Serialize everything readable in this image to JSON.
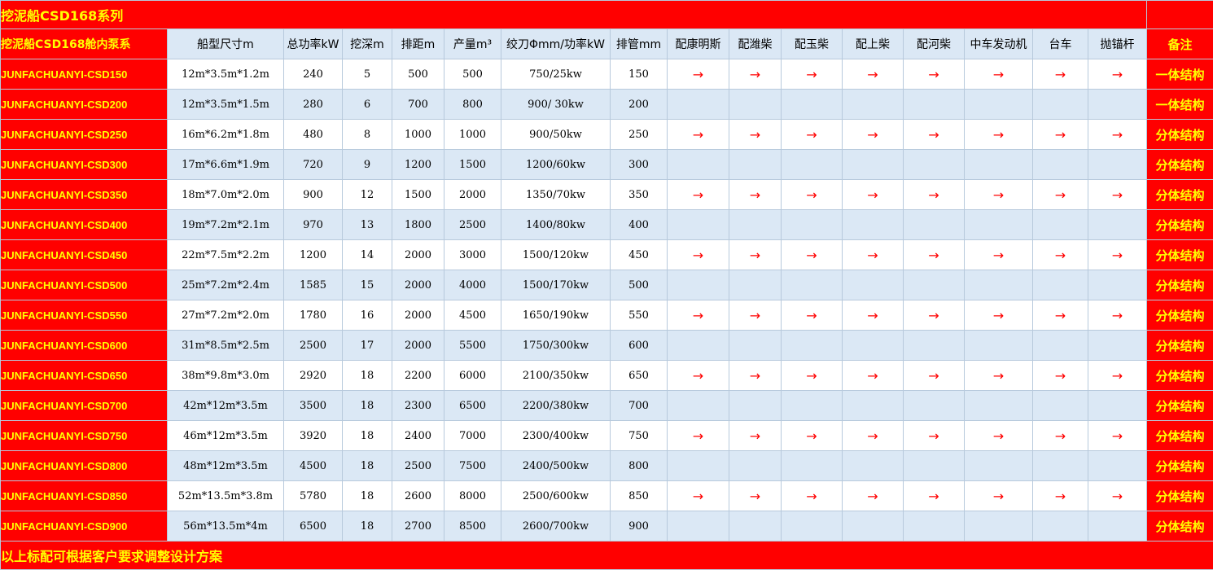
{
  "title": "挖泥船CSD168系列",
  "headers": {
    "model": "挖泥船CSD168舱内泵系",
    "size": "船型尺寸m",
    "power": "总功率kW",
    "depth": "挖深m",
    "distance": "排距m",
    "output": "产量m³",
    "cutter": "绞刀Φmm/功率kW",
    "pipe": "排管mm",
    "cummins": "配康明斯",
    "weichai": "配潍柴",
    "yuchai": "配玉柴",
    "shangchai": "配上柴",
    "hechai": "配河柴",
    "sinotruk": "中车发动机",
    "trolley": "台车",
    "anchor": "抛锚杆",
    "note": "备注"
  },
  "arrow_symbol": "→",
  "arrow_color": "#ff0000",
  "background_red": "#ff0000",
  "text_yellow": "#ffff00",
  "row_alt_color": "#dbe8f5",
  "rows": [
    {
      "model": "JUNFACHUANYI-CSD150",
      "size": "12m*3.5m*1.2m",
      "power": "240",
      "depth": "5",
      "distance": "500",
      "output": "500",
      "cutter": "750/25kw",
      "pipe": "150",
      "arrows": true,
      "note": "一体结构"
    },
    {
      "model": "JUNFACHUANYI-CSD200",
      "size": "12m*3.5m*1.5m",
      "power": "280",
      "depth": "6",
      "distance": "700",
      "output": "800",
      "cutter": "900/ 30kw",
      "pipe": "200",
      "arrows": false,
      "note": "一体结构"
    },
    {
      "model": "JUNFACHUANYI-CSD250",
      "size": "16m*6.2m*1.8m",
      "power": "480",
      "depth": "8",
      "distance": "1000",
      "output": "1000",
      "cutter": "900/50kw",
      "pipe": "250",
      "arrows": true,
      "note": "分体结构"
    },
    {
      "model": "JUNFACHUANYI-CSD300",
      "size": "17m*6.6m*1.9m",
      "power": "720",
      "depth": "9",
      "distance": "1200",
      "output": "1500",
      "cutter": "1200/60kw",
      "pipe": "300",
      "arrows": false,
      "note": "分体结构"
    },
    {
      "model": "JUNFACHUANYI-CSD350",
      "size": "18m*7.0m*2.0m",
      "power": "900",
      "depth": "12",
      "distance": "1500",
      "output": "2000",
      "cutter": "1350/70kw",
      "pipe": "350",
      "arrows": true,
      "note": "分体结构"
    },
    {
      "model": "JUNFACHUANYI-CSD400",
      "size": "19m*7.2m*2.1m",
      "power": "970",
      "depth": "13",
      "distance": "1800",
      "output": "2500",
      "cutter": "1400/80kw",
      "pipe": "400",
      "arrows": false,
      "note": "分体结构"
    },
    {
      "model": "JUNFACHUANYI-CSD450",
      "size": "22m*7.5m*2.2m",
      "power": "1200",
      "depth": "14",
      "distance": "2000",
      "output": "3000",
      "cutter": "1500/120kw",
      "pipe": "450",
      "arrows": true,
      "note": "分体结构"
    },
    {
      "model": "JUNFACHUANYI-CSD500",
      "size": "25m*7.2m*2.4m",
      "power": "1585",
      "depth": "15",
      "distance": "2000",
      "output": "4000",
      "cutter": "1500/170kw",
      "pipe": "500",
      "arrows": false,
      "note": "分体结构"
    },
    {
      "model": "JUNFACHUANYI-CSD550",
      "size": "27m*7.2m*2.0m",
      "power": "1780",
      "depth": "16",
      "distance": "2000",
      "output": "4500",
      "cutter": "1650/190kw",
      "pipe": "550",
      "arrows": true,
      "note": "分体结构"
    },
    {
      "model": "JUNFACHUANYI-CSD600",
      "size": "31m*8.5m*2.5m",
      "power": "2500",
      "depth": "17",
      "distance": "2000",
      "output": "5500",
      "cutter": "1750/300kw",
      "pipe": "600",
      "arrows": false,
      "note": "分体结构"
    },
    {
      "model": "JUNFACHUANYI-CSD650",
      "size": "38m*9.8m*3.0m",
      "power": "2920",
      "depth": "18",
      "distance": "2200",
      "output": "6000",
      "cutter": "2100/350kw",
      "pipe": "650",
      "arrows": true,
      "note": "分体结构"
    },
    {
      "model": "JUNFACHUANYI-CSD700",
      "size": "42m*12m*3.5m",
      "power": "3500",
      "depth": "18",
      "distance": "2300",
      "output": "6500",
      "cutter": "2200/380kw",
      "pipe": "700",
      "arrows": false,
      "note": "分体结构"
    },
    {
      "model": "JUNFACHUANYI-CSD750",
      "size": "46m*12m*3.5m",
      "power": "3920",
      "depth": "18",
      "distance": "2400",
      "output": "7000",
      "cutter": "2300/400kw",
      "pipe": "750",
      "arrows": true,
      "note": "分体结构"
    },
    {
      "model": "JUNFACHUANYI-CSD800",
      "size": "48m*12m*3.5m",
      "power": "4500",
      "depth": "18",
      "distance": "2500",
      "output": "7500",
      "cutter": "2400/500kw",
      "pipe": "800",
      "arrows": false,
      "note": "分体结构"
    },
    {
      "model": "JUNFACHUANYI-CSD850",
      "size": "52m*13.5m*3.8m",
      "power": "5780",
      "depth": "18",
      "distance": "2600",
      "output": "8000",
      "cutter": "2500/600kw",
      "pipe": "850",
      "arrows": true,
      "note": "分体结构"
    },
    {
      "model": "JUNFACHUANYI-CSD900",
      "size": "56m*13.5m*4m",
      "power": "6500",
      "depth": "18",
      "distance": "2700",
      "output": "8500",
      "cutter": "2600/700kw",
      "pipe": "900",
      "arrows": false,
      "note": "分体结构"
    }
  ],
  "footer": "以上标配可根据客户要求调整设计方案"
}
